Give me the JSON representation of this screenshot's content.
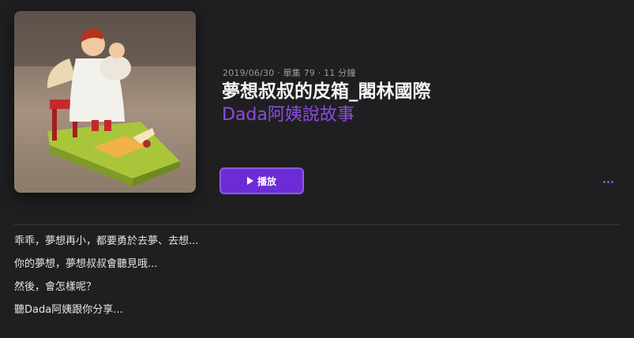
{
  "episode": {
    "meta": "2019/06/30 · 單集 79 · 11 分鐘",
    "title": "夢想叔叔的皮箱_閣林國際",
    "show_name": "Dada阿姨說故事",
    "play_label": "播放",
    "artwork_icon": "wooden-angel-figurine-artwork",
    "more_icon": "ellipsis-icon"
  },
  "description": {
    "lines": [
      "乖乖，夢想再小，都要勇於去夢、去想...",
      "你的夢想，夢想叔叔會聽見哦...",
      "然後，會怎樣呢？",
      "聽Dada阿姨跟你分享..."
    ]
  },
  "colors": {
    "background": "#1f1f21",
    "accent": "#6d2bd6",
    "show_name": "#8d4be0"
  }
}
